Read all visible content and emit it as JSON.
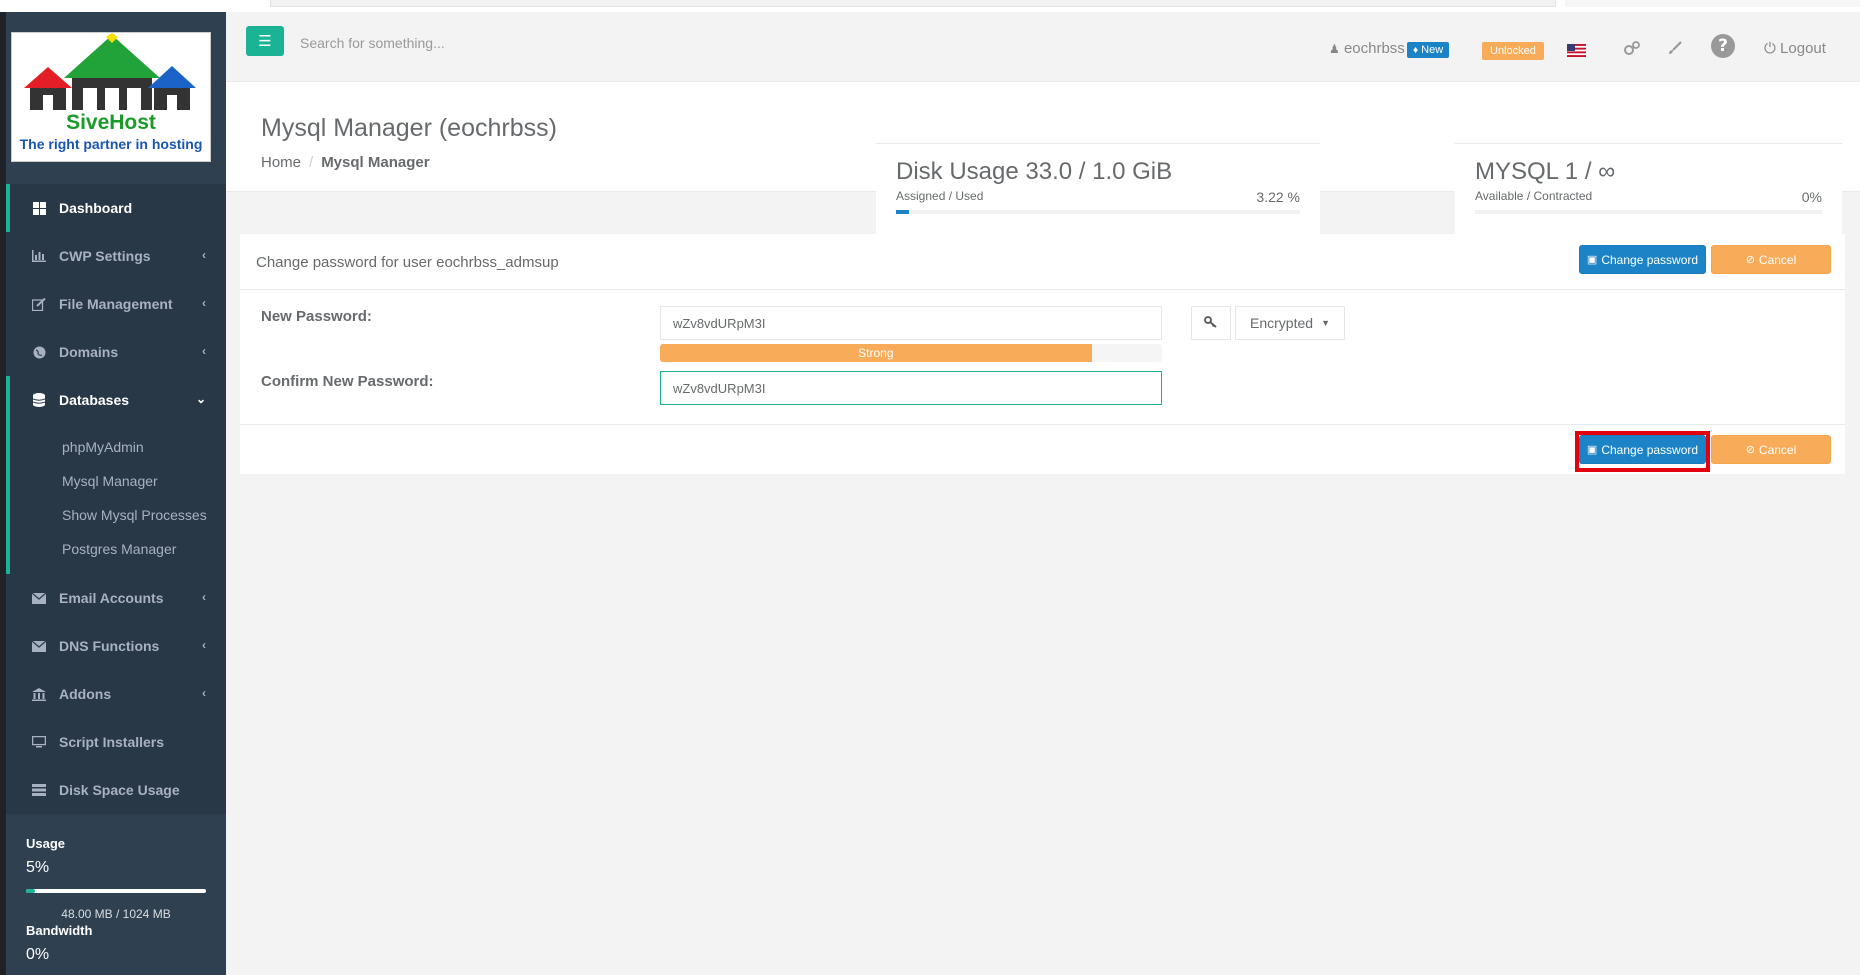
{
  "brand": {
    "name": "SiveHost",
    "tagline": "The right partner in hosting"
  },
  "header": {
    "search_placeholder": "Search for something...",
    "username": "eochrbss",
    "new_badge": "New",
    "unlocked_badge": "Unlocked",
    "logout_label": "Logout"
  },
  "sidebar": {
    "items": [
      {
        "label": "Dashboard",
        "icon": "dashboard-icon"
      },
      {
        "label": "CWP Settings",
        "icon": "chart-icon"
      },
      {
        "label": "File Management",
        "icon": "edit-icon"
      },
      {
        "label": "Domains",
        "icon": "globe-icon"
      },
      {
        "label": "Databases",
        "icon": "database-icon"
      },
      {
        "label": "Email Accounts",
        "icon": "envelope-icon"
      },
      {
        "label": "DNS Functions",
        "icon": "envelope-icon"
      },
      {
        "label": "Addons",
        "icon": "bank-icon"
      },
      {
        "label": "Script Installers",
        "icon": "monitor-icon"
      },
      {
        "label": "Disk Space Usage",
        "icon": "storage-icon"
      }
    ],
    "databases_sub": [
      "phpMyAdmin",
      "Mysql Manager",
      "Show Mysql Processes",
      "Postgres Manager"
    ],
    "usage": {
      "usage_label": "Usage",
      "usage_pct": "5%",
      "usage_fraction": 0.05,
      "usage_detail": "48.00 MB / 1024 MB",
      "bandwidth_label": "Bandwidth",
      "bandwidth_pct": "0%"
    }
  },
  "page": {
    "title": "Mysql Manager (eochrbss)",
    "breadcrumb_home": "Home",
    "breadcrumb_current": "Mysql Manager"
  },
  "stats": {
    "disk": {
      "title": "Disk Usage 33.0 / 1.0 GiB",
      "caption": "Assigned / Used",
      "value": "3.22 %",
      "fraction": 0.0322
    },
    "mysql": {
      "title": "MYSQL 1 / ∞",
      "caption": "Available / Contracted",
      "value": "0%",
      "fraction": 0
    }
  },
  "panel": {
    "title": "Change password for user eochrbss_admsup",
    "change_label": "Change password",
    "cancel_label": "Cancel",
    "new_password_label": "New Password:",
    "new_password_value": "wZv8vdURpM3I",
    "strength_label": "Strong",
    "strength_fraction": 0.86,
    "confirm_label": "Confirm New Password:",
    "confirm_value": "wZv8vdURpM3I",
    "encrypted_label": "Encrypted"
  },
  "colors": {
    "accent": "#1ab394",
    "primary": "#1c84c6",
    "warning": "#f8ac59",
    "sidebar": "#2f4050",
    "highlight": "#e3000f"
  }
}
